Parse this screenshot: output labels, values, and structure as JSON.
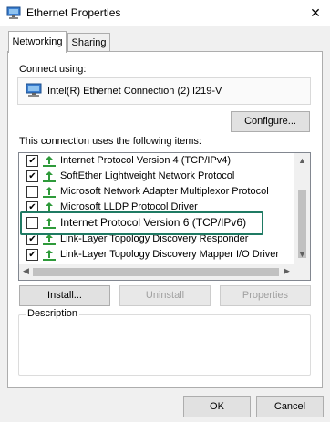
{
  "window": {
    "title": "Ethernet Properties",
    "close_glyph": "✕"
  },
  "tabs": [
    {
      "label": "Networking",
      "active": true
    },
    {
      "label": "Sharing",
      "active": false
    }
  ],
  "connect_using": {
    "label": "Connect using:",
    "adapter": "Intel(R) Ethernet Connection (2) I219-V"
  },
  "configure_button": "Configure...",
  "components_label": "This connection uses the following items:",
  "components": [
    {
      "label": "Internet Protocol Version 4 (TCP/IPv4)",
      "checked": true,
      "icon": "network-protocol-icon"
    },
    {
      "label": "SoftEther Lightweight Network Protocol",
      "checked": true,
      "icon": "network-protocol-icon"
    },
    {
      "label": "Microsoft Network Adapter Multiplexor Protocol",
      "checked": false,
      "icon": "network-protocol-icon"
    },
    {
      "label": "Microsoft LLDP Protocol Driver",
      "checked": true,
      "icon": "network-protocol-icon"
    },
    {
      "label": "Internet Protocol Version 6 (TCP/IPv6)",
      "checked": false,
      "icon": "network-protocol-icon",
      "highlighted": true
    },
    {
      "label": "Link-Layer Topology Discovery Responder",
      "checked": true,
      "icon": "network-protocol-icon"
    },
    {
      "label": "Link-Layer Topology Discovery Mapper I/O Driver",
      "checked": true,
      "icon": "network-protocol-icon"
    }
  ],
  "buttons": {
    "install": "Install...",
    "uninstall": "Uninstall",
    "properties": "Properties"
  },
  "description": {
    "title": "Description",
    "text": ""
  },
  "footer": {
    "ok": "OK",
    "cancel": "Cancel"
  },
  "colors": {
    "highlight_border": "#1f7a63",
    "protocol_icon": "#2e9a3a"
  }
}
